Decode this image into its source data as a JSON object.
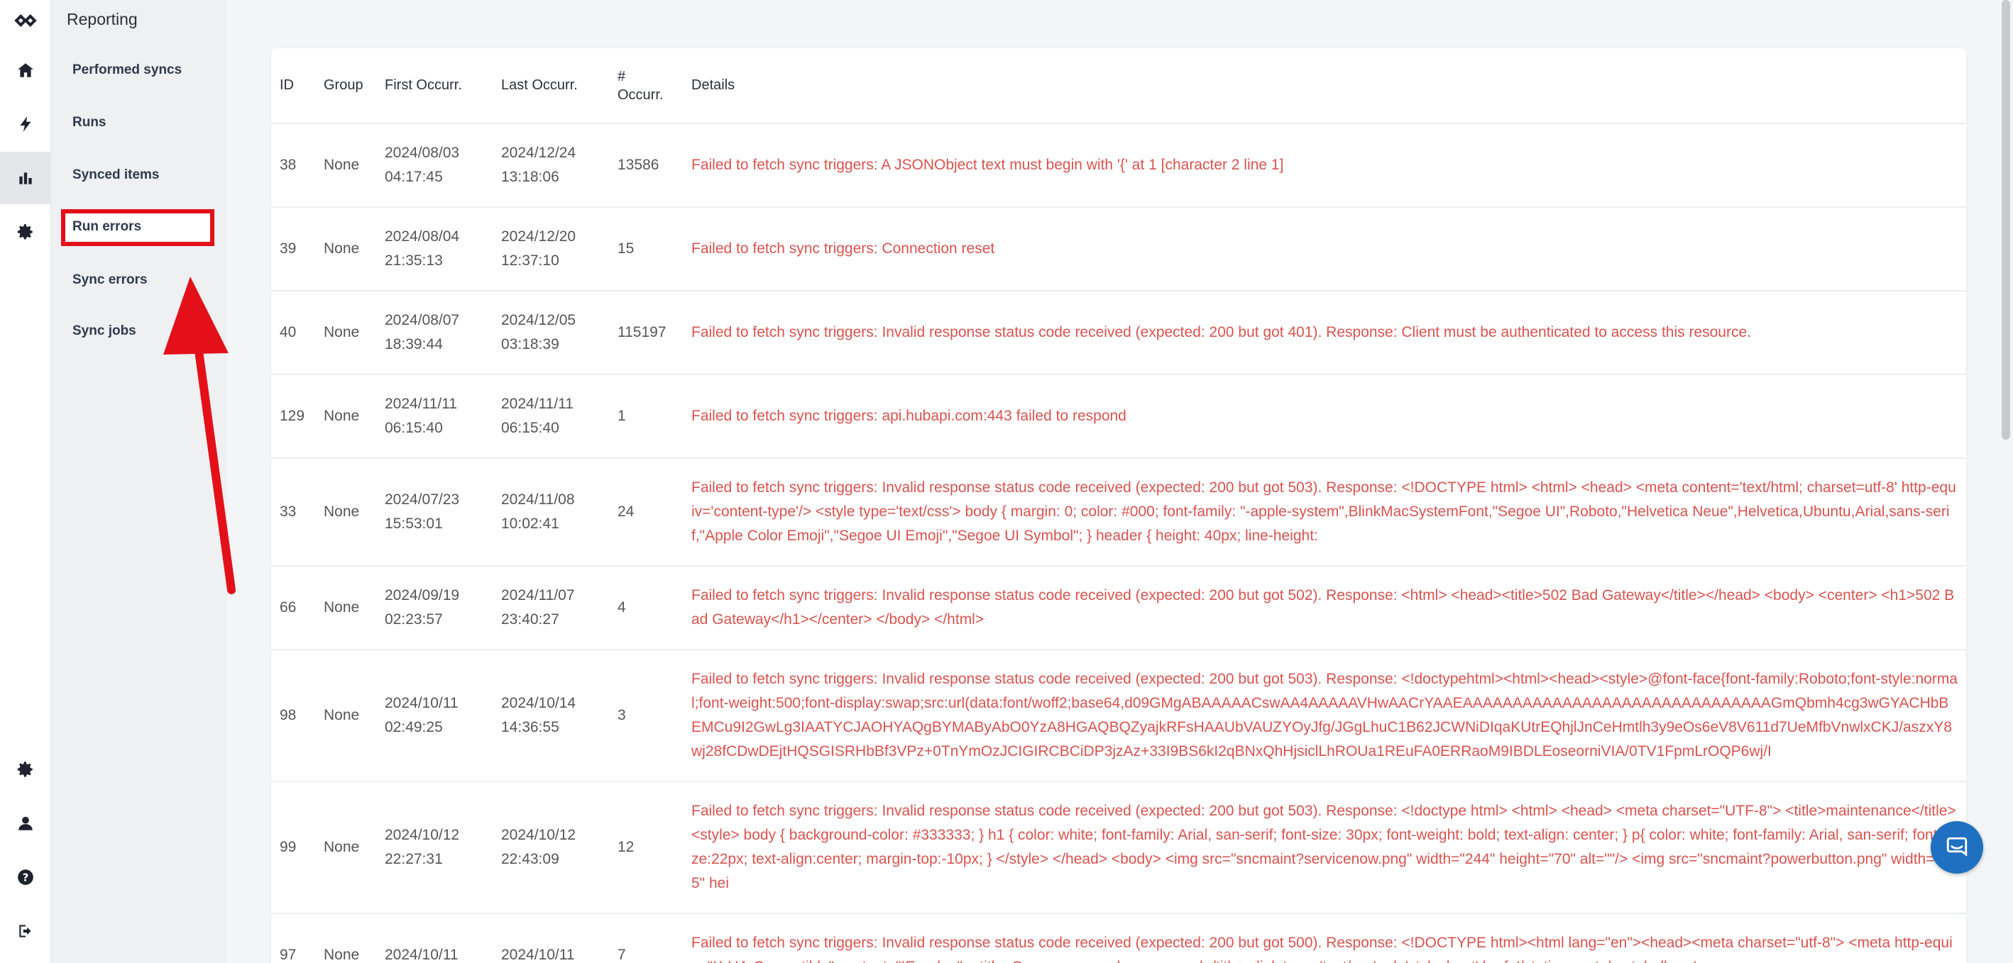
{
  "submenu": {
    "title": "Reporting",
    "items": [
      {
        "label": "Performed syncs"
      },
      {
        "label": "Runs"
      },
      {
        "label": "Synced items"
      },
      {
        "label": "Run errors"
      },
      {
        "label": "Sync errors"
      },
      {
        "label": "Sync jobs"
      }
    ]
  },
  "rail": {
    "icons": [
      "logo-icon",
      "home-icon",
      "bolt-icon",
      "bar-chart-icon",
      "gear-icon",
      "settings-icon",
      "user-icon",
      "help-icon",
      "logout-icon"
    ],
    "active": "bar-chart-icon"
  },
  "table": {
    "headers": [
      "ID",
      "Group",
      "First Occurr.",
      "Last Occurr.",
      "# Occurr.",
      "Details"
    ],
    "rows": [
      {
        "id": "38",
        "group": "None",
        "first": "2024/08/03 04:17:45",
        "last": "2024/12/24 13:18:06",
        "count": "13586",
        "details": "Failed to fetch sync triggers: A JSONObject text must begin with '{' at 1 [character 2 line 1]"
      },
      {
        "id": "39",
        "group": "None",
        "first": "2024/08/04 21:35:13",
        "last": "2024/12/20 12:37:10",
        "count": "15",
        "details": "Failed to fetch sync triggers: Connection reset"
      },
      {
        "id": "40",
        "group": "None",
        "first": "2024/08/07 18:39:44",
        "last": "2024/12/05 03:18:39",
        "count": "115197",
        "details": "Failed to fetch sync triggers: Invalid response status code received (expected: 200 but got 401). Response: Client must be authenticated to access this resource."
      },
      {
        "id": "129",
        "group": "None",
        "first": "2024/11/11 06:15:40",
        "last": "2024/11/11 06:15:40",
        "count": "1",
        "details": "Failed to fetch sync triggers: api.hubapi.com:443 failed to respond"
      },
      {
        "id": "33",
        "group": "None",
        "first": "2024/07/23 15:53:01",
        "last": "2024/11/08 10:02:41",
        "count": "24",
        "details": "Failed to fetch sync triggers: Invalid response status code received (expected: 200 but got 503). Response: <!DOCTYPE html> <html> <head> <meta content='text/html; charset=utf-8' http-equiv='content-type'/> <style type='text/css'> body { margin: 0; color: #000; font-family: \"-apple-system\",BlinkMacSystemFont,\"Segoe UI\",Roboto,\"Helvetica Neue\",Helvetica,Ubuntu,Arial,sans-serif,\"Apple Color Emoji\",\"Segoe UI Emoji\",\"Segoe UI Symbol\"; } header { height: 40px; line-height:"
      },
      {
        "id": "66",
        "group": "None",
        "first": "2024/09/19 02:23:57",
        "last": "2024/11/07 23:40:27",
        "count": "4",
        "details": "Failed to fetch sync triggers: Invalid response status code received (expected: 200 but got 502). Response: <html> <head><title>502 Bad Gateway</title></head> <body> <center> <h1>502 Bad Gateway</h1></center> </body> </html>"
      },
      {
        "id": "98",
        "group": "None",
        "first": "2024/10/11 02:49:25",
        "last": "2024/10/14 14:36:55",
        "count": "3",
        "details": "Failed to fetch sync triggers: Invalid response status code received (expected: 200 but got 503). Response: <!doctypehtml><html><head><style>@font-face{font-family:Roboto;font-style:normal;font-weight:500;font-display:swap;src:url(data:font/woff2;base64,d09GMgABAAAAACswAA4AAAAAVHwAACrYAAEAAAAAAAAAAAAAAAAAAAAAAAAAAAAAAAGmQbmh4cg3wGYACHbBEMCu9I2GwLg3IAATYCJAOHYAQgBYMAByAbO0YzA8HGAQBQZyajkRFsHAAUbVAUZYOyJfg/JGgLhuC1B62JCWNiDIqaKUtrEQhjlJnCeHmtlh3y9eOs6eV8V611d7UeMfbVnwlxCKJ/aszxY8wj28fCDwDEjtHQSGISRHbBf3VPz+0TnYmOzJCIGIRCBCiDP3jzAz+33I9BS6kI2qBNxQhHjsiclLhROUa1REuFA0ERRaoM9IBDLEoseorniVIA/0TV1FpmLrOQP6wj/I"
      },
      {
        "id": "99",
        "group": "None",
        "first": "2024/10/12 22:27:31",
        "last": "2024/10/12 22:43:09",
        "count": "12",
        "details": "Failed to fetch sync triggers: Invalid response status code received (expected: 200 but got 503). Response: <!doctype html> <html> <head> <meta charset=\"UTF-8\"> <title>maintenance</title> <style> body { background-color: #333333; } h1 { color: white; font-family: Arial, san-serif; font-size: 30px; font-weight: bold; text-align: center; } p{ color: white; font-family: Arial, san-serif; font-size:22px; text-align:center; margin-top:-10px; } </style> </head> <body> <img src=\"sncmaint?servicenow.png\" width=\"244\" height=\"70\" alt=\"\"/> <img src=\"sncmaint?powerbutton.png\" width=\"265\" hei"
      },
      {
        "id": "97",
        "group": "None",
        "first": "2024/10/11",
        "last": "2024/10/11",
        "count": "7",
        "details": "Failed to fetch sync triggers: Invalid response status code received (expected: 200 but got 500). Response: <!DOCTYPE html><html lang=\"en\"><head><meta charset=\"utf-8\"> <meta http-equiv=\"X-UA-Compatible\" content=\"IE=edge\"><title>Oops - an error has occurred</title><link type='text/css' rel='stylesheet' href='/static-assets/metal-all.css'"
      }
    ]
  },
  "colors": {
    "details_text": "#d9534f",
    "highlight": "#e3101a",
    "chat": "#1f70c1"
  }
}
